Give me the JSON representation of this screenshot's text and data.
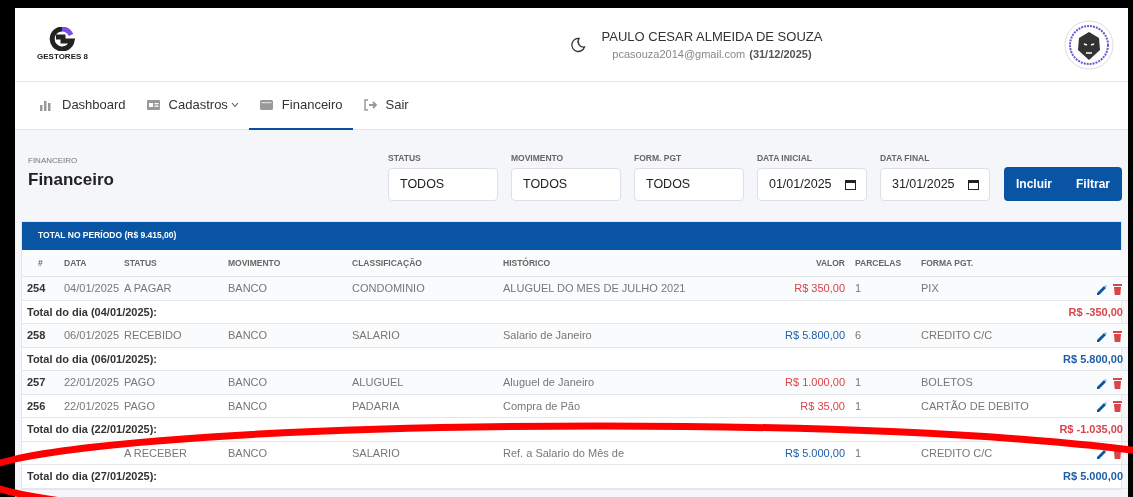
{
  "header": {
    "logo_text": "GESTORES 8",
    "user_name": "PAULO CESAR ALMEIDA DE SOUZA",
    "user_email": "pcasouza2014@gmail.com",
    "user_expiry": "(31/12/2025)"
  },
  "nav": [
    {
      "label": "Dashboard",
      "selected": false,
      "dropdown": false
    },
    {
      "label": "Cadastros",
      "selected": false,
      "dropdown": true
    },
    {
      "label": "Financeiro",
      "selected": true,
      "dropdown": false
    },
    {
      "label": "Sair",
      "selected": false,
      "dropdown": false
    }
  ],
  "page": {
    "breadcrumb": "FINANCEIRO",
    "title": "Financeiro"
  },
  "filters": [
    {
      "label": "STATUS",
      "value": "TODOS",
      "kind": "select"
    },
    {
      "label": "MOVIMENTO",
      "value": "TODOS",
      "kind": "select"
    },
    {
      "label": "FORM. PGT",
      "value": "TODOS",
      "kind": "select"
    },
    {
      "label": "DATA INICIAL",
      "value": "01/01/2025",
      "kind": "date"
    },
    {
      "label": "DATA FINAL",
      "value": "31/01/2025",
      "kind": "date"
    }
  ],
  "buttons": [
    "Incluir",
    "Filtrar"
  ],
  "table": {
    "summary": "TOTAL NO PERÍODO (R$ 9.415,00)",
    "columns": [
      "#",
      "DATA",
      "STATUS",
      "MOVIMENTO",
      "CLASSIFICAÇÃO",
      "HISTÓRICO",
      "VALOR",
      "PARCELAS",
      "FORMA PGT."
    ],
    "groups": [
      {
        "rows": [
          {
            "id": "254",
            "date": "04/01/2025",
            "status": "A PAGAR",
            "movement": "BANCO",
            "classification": "CONDOMINIO",
            "history": "ALUGUEL DO MES DE JULHO 2021",
            "value": "R$ 350,00",
            "kind": "debit",
            "installments": "1",
            "payment": "PIX"
          }
        ],
        "total_label": "Total do dia (04/01/2025):",
        "total": "R$ -350,00",
        "kind": "debit"
      },
      {
        "rows": [
          {
            "id": "258",
            "date": "06/01/2025",
            "status": "RECEBIDO",
            "movement": "BANCO",
            "classification": "SALARIO",
            "history": "Salario de Janeiro",
            "value": "R$ 5.800,00",
            "kind": "credit",
            "installments": "6",
            "payment": "CREDITO C/C"
          }
        ],
        "total_label": "Total do dia (06/01/2025):",
        "total": "R$ 5.800,00",
        "kind": "credit"
      },
      {
        "rows": [
          {
            "id": "257",
            "date": "22/01/2025",
            "status": "PAGO",
            "movement": "BANCO",
            "classification": "ALUGUEL",
            "history": "Aluguel de Janeiro",
            "value": "R$ 1.000,00",
            "kind": "debit",
            "installments": "1",
            "payment": "BOLETOS"
          },
          {
            "id": "256",
            "date": "22/01/2025",
            "status": "PAGO",
            "movement": "BANCO",
            "classification": "PADARIA",
            "history": "Compra de Pão",
            "value": "R$ 35,00",
            "kind": "debit",
            "installments": "1",
            "payment": "CARTÃO DE DEBITO"
          }
        ],
        "total_label": "Total do dia (22/01/2025):",
        "total": "R$ -1.035,00",
        "kind": "debit"
      },
      {
        "rows": [
          {
            "status": "A RECEBER",
            "movement": "BANCO",
            "classification": "SALARIO",
            "history": "Ref. a Salario do Mês de",
            "value": "R$ 5.000,00",
            "kind": "credit",
            "installments": "1",
            "payment": "CREDITO C/C"
          }
        ],
        "total_label": "Total do dia (27/01/2025):",
        "total": "R$ 5.000,00",
        "kind": "credit"
      }
    ]
  }
}
